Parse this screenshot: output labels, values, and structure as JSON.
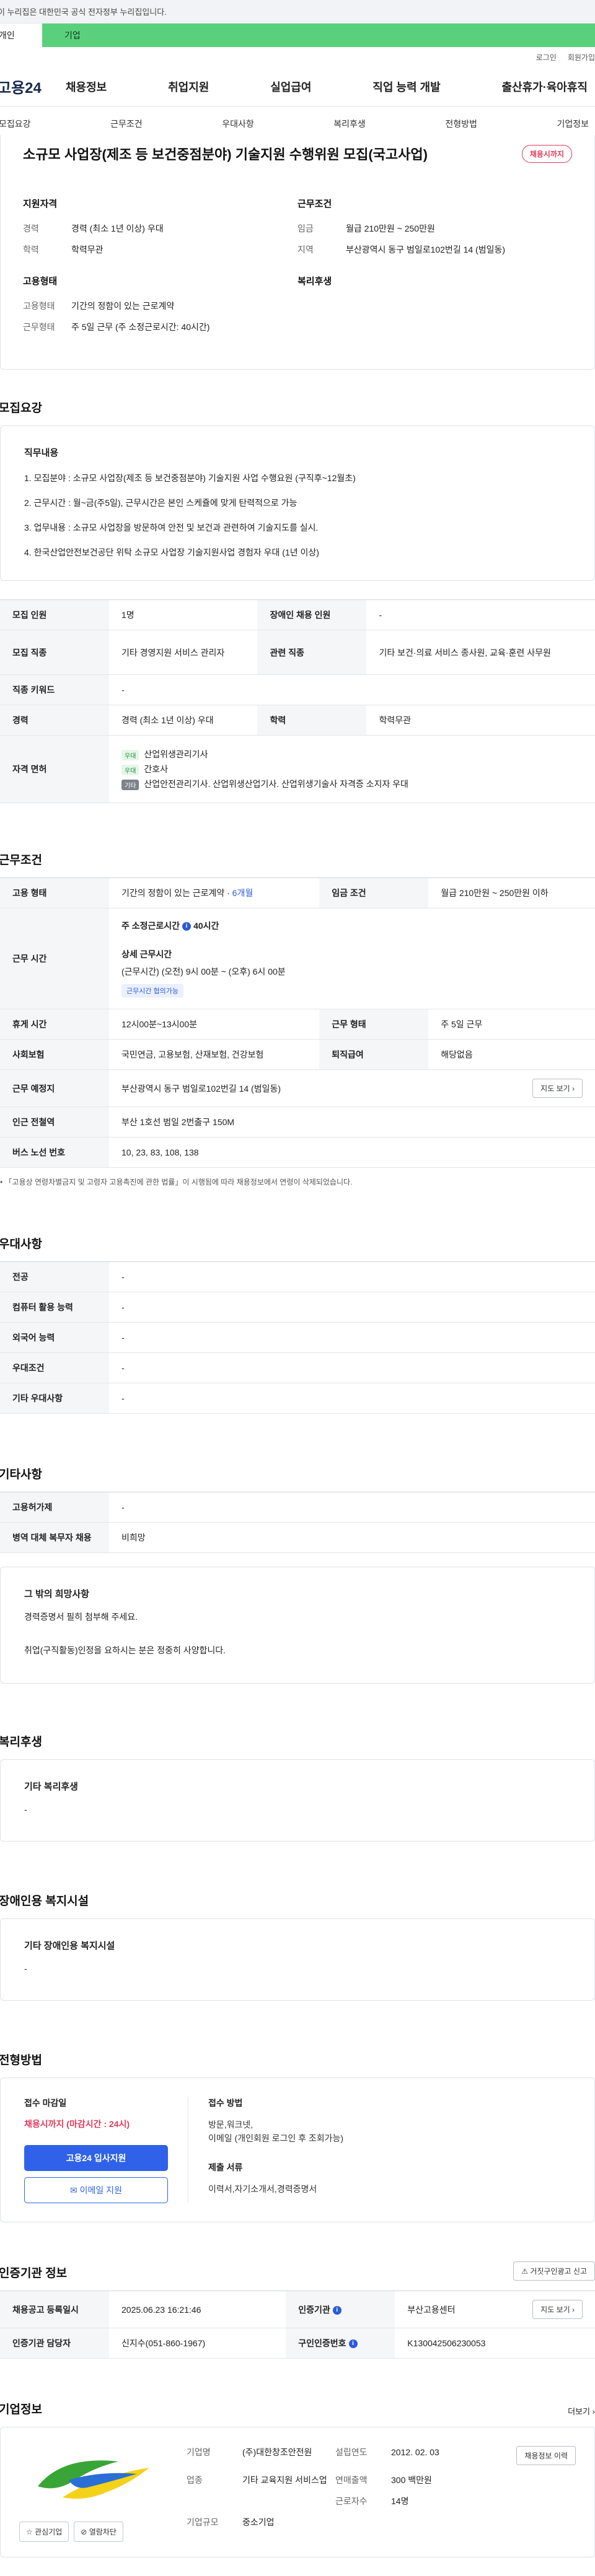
{
  "gov_banner": "이 누리집은 대한민국 공식 전자정부 누리집입니다.",
  "tabs": {
    "left": "개인",
    "right": "기업"
  },
  "util": [
    "로그인",
    "회원가입"
  ],
  "logo": "고용24",
  "gnb": [
    "채용정보",
    "취업지원",
    "실업급여",
    "직업 능력 개발",
    "출산휴가·육아휴직"
  ],
  "subnav": [
    "모집요강",
    "근무조건",
    "우대사항",
    "복리후생",
    "전형방법",
    "기업정보"
  ],
  "job": {
    "title": "소규모 사업장(제조 등 보건중점분야) 기술지원 수행위원 모집(국고사업)",
    "badge": "채용시까지",
    "qual_h": "지원자격",
    "cond_h": "근무조건",
    "emp_h": "고용형태",
    "welfare_h": "복리후생",
    "qual": [
      {
        "k": "경력",
        "v": "경력 (최소 1년 이상) 우대"
      },
      {
        "k": "학력",
        "v": "학력무관"
      }
    ],
    "cond": [
      {
        "k": "임금",
        "v": "월급 210만원 ~ 250만원"
      },
      {
        "k": "지역",
        "v": "부산광역시 동구 범일로102번길 14 (범일동)"
      }
    ],
    "emp": [
      {
        "k": "고용형태",
        "v": "기간의 정함이 있는 근로계약"
      },
      {
        "k": "근무형태",
        "v": "주 5일 근무 (주 소정근로시간: 40시간)"
      }
    ]
  },
  "recruit": {
    "title": "모집요강",
    "duty_h": "직무내용",
    "duties": [
      "1. 모집분야 : 소규모 사업장(제조 등 보건중점분야) 기술지원 사업 수행요원 (구직후~12월초)",
      "2. 근무시간 : 월~금(주5일), 근무시간은 본인 스케쥴에 맞게 탄력적으로 가능",
      "3. 업무내용 : 소규모 사업장을 방문하여 안전 및 보건과 관련하여 기술지도를 실시.",
      "4. 한국산업안전보건공단 위탁 소규모 사업장 기술지원사업 경험자 우대 (1년 이상)"
    ],
    "rows": {
      "count_k": "모집 인원",
      "count_v": "1명",
      "disabled_k": "장애인 채용 인원",
      "disabled_v": "-",
      "job_k": "모집 직종",
      "job_v": "기타 경영지원 서비스 관리자",
      "rel_k": "관련 직종",
      "rel_v": "기타 보건·의료 서비스 종사원, 교육·훈련 사무원",
      "kw_k": "직종 키워드",
      "kw_v": "-",
      "career_k": "경력",
      "career_v": "경력 (최소 1년 이상) 우대",
      "edu_k": "학력",
      "edu_v": "학력무관",
      "lic_k": "자격 면허",
      "lic_tag1": "우대",
      "lic1": "산업위생관리기사",
      "lic_tag2": "우대",
      "lic2": "간호사",
      "lic_tag3": "기타",
      "lic3": "산업안전관리기사. 산업위생산업기사. 산업위생기술사 자격증 소지자 우대"
    }
  },
  "work": {
    "title": "근무조건",
    "emp_k": "고용 형태",
    "emp_v": "기간의 정함이 있는 근로계약 · ",
    "emp_months": "6개월",
    "wage_k": "임금 조건",
    "wage_v": "월급 210만원 ~ 250만원 이하",
    "time_k": "근무 시간",
    "time_main": "주 소정근로시간",
    "time_hours": "40시간",
    "time_detail_h": "상세 근무시간",
    "time_detail": "(근무시간) (오전) 9시 00분 ~ (오후) 6시 00분",
    "time_chip": "근무시간 협의가능",
    "rest_k": "휴게 시간",
    "rest_v": "12시00분~13시00분",
    "form_k": "근무 형태",
    "form_v": "주 5일 근무",
    "ins_k": "사회보험",
    "ins_v": "국민연금, 고용보험, 산재보험, 건강보험",
    "pay_k": "퇴직급여",
    "pay_v": "해당없음",
    "loc_k": "근무 예정지",
    "loc_v": "부산광역시 동구 범일로102번길 14 (범일동)",
    "map_btn": "지도 보기",
    "sub_k": "인근 전철역",
    "sub_v": "부산 1호선 범일 2번출구 150M",
    "bus_k": "버스 노선 번호",
    "bus_v": "10, 23, 83, 108, 138",
    "footnote": "「고용상 연령차별금지 및 고령자 고용촉진에 관한 법률」이 시행됨에 따라 채용정보에서 연령이 삭제되었습니다."
  },
  "pref": {
    "title": "우대사항",
    "rows": [
      {
        "k": "전공",
        "v": "-"
      },
      {
        "k": "컴퓨터 활용 능력",
        "v": "-"
      },
      {
        "k": "외국어 능력",
        "v": "-"
      },
      {
        "k": "우대조건",
        "v": "-"
      },
      {
        "k": "기타 우대사항",
        "v": "-"
      }
    ]
  },
  "etc": {
    "title": "기타사항",
    "rows": [
      {
        "k": "고용허가제",
        "v": "-"
      },
      {
        "k": "병역 대체 복무자 채용",
        "v": "비희망"
      }
    ],
    "wish_h": "그 밖의 희망사항",
    "wish1": "경력증명서 필히 첨부해 주세요.",
    "wish2": "취업(구직활동)인정을 요하시는 분은 정중히 사양합니다."
  },
  "welfare": {
    "title": "복리후생",
    "h": "기타 복리후생",
    "v": "-"
  },
  "disabled": {
    "title": "장애인용 복지시설",
    "h": "기타 장애인용 복지시설",
    "v": "-"
  },
  "apply": {
    "title": "전형방법",
    "deadline_h": "접수 마감일",
    "deadline": "채용시까지 (마감시간 : 24시)",
    "btn1": "고용24 입사지원",
    "btn2": "이메일 지원",
    "method_h": "접수 방법",
    "method1": "방문,워크넷,",
    "method2": "이메일 (개인회원 로그인 후 조회가능)",
    "docs_h": "제출 서류",
    "docs": "이력서,자기소개서,경력증명서"
  },
  "cert": {
    "title": "인증기관 정보",
    "report_btn": "거짓구인광고 신고",
    "reg_k": "채용공고 등록일시",
    "reg_v": "2025.06.23 16:21:46",
    "org_k": "인증기관",
    "org_v": "부산고용센터",
    "map_btn": "지도 보기",
    "mgr_k": "인증기관 담당자",
    "mgr_v": "신지수(051-860-1967)",
    "id_k": "구인인증번호",
    "id_v": "K130042506230053"
  },
  "company": {
    "title": "기업정보",
    "more": "더보기",
    "fav_btn": "관심기업",
    "block_btn": "열람차단",
    "name_k": "기업명",
    "name_v": "(주)대한창조안전원",
    "est_k": "설립연도",
    "est_v": "2012. 02. 03",
    "ind_k": "업종",
    "ind_v": "기타 교육지원 서비스업",
    "sales_k": "연매출액",
    "sales_v": "300 백만원",
    "emp_k": "근로자수",
    "emp_v": "14명",
    "size_k": "기업규모",
    "size_v": "중소기업",
    "info_btn": "채용정보 이력"
  },
  "colors": {
    "accent": "#2f62e8",
    "alert": "#e23a5b",
    "tab_green": "#5ad07c"
  }
}
